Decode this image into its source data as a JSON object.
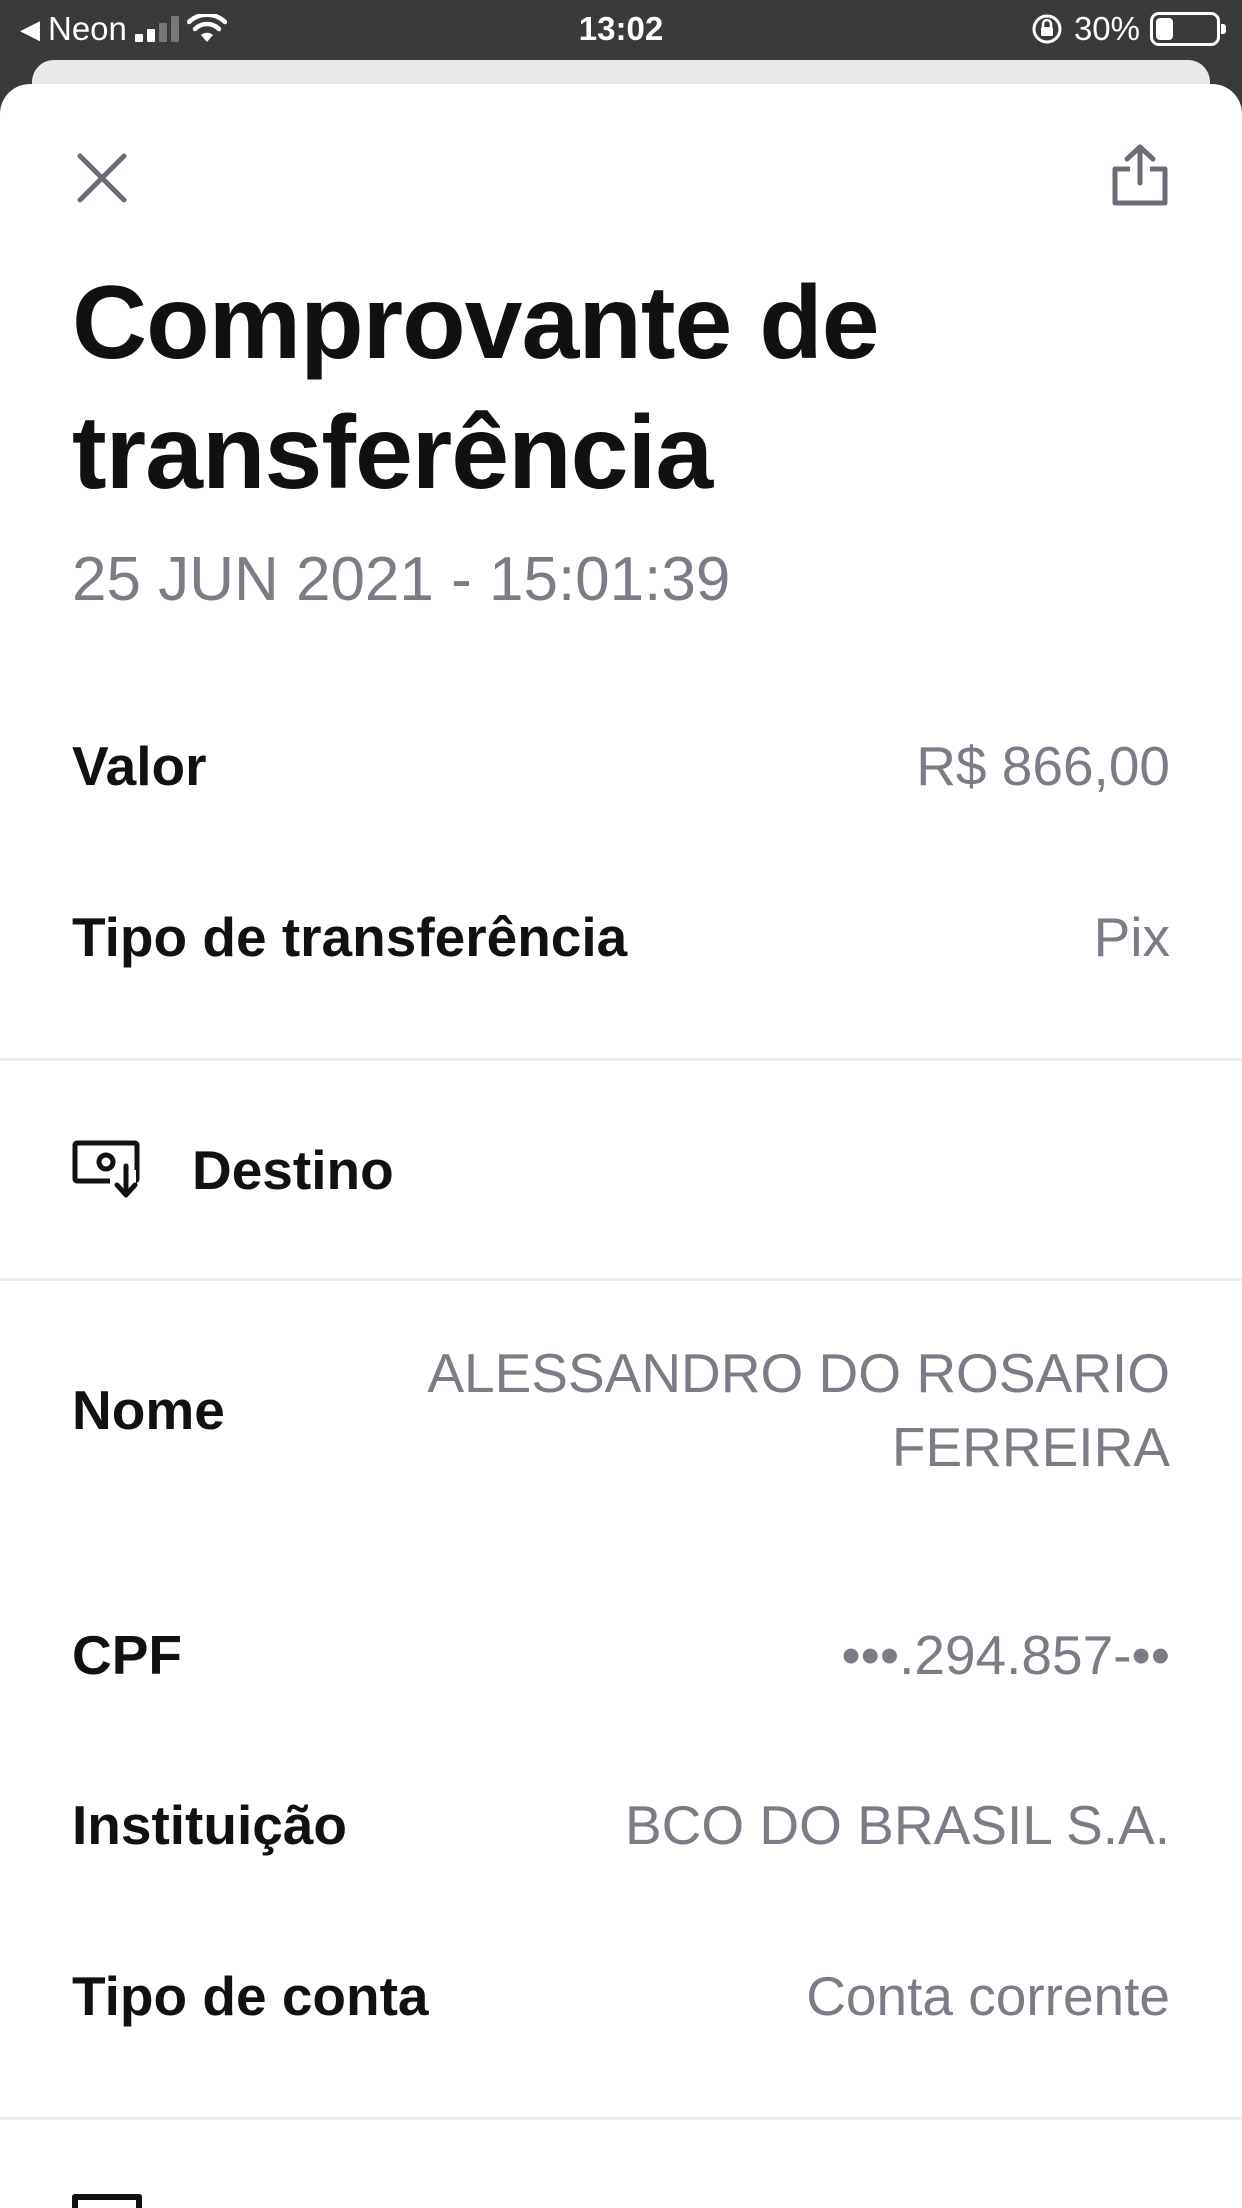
{
  "status_bar": {
    "carrier": "Neon",
    "time": "13:02",
    "battery": "30%"
  },
  "header": {
    "title_line1": "Comprovante de",
    "title_line2": "transferência",
    "date": "25 JUN 2021 - 15:01:39"
  },
  "summary": {
    "valor_label": "Valor",
    "valor_value": "R$ 866,00",
    "tipo_label": "Tipo de transferência",
    "tipo_value": "Pix"
  },
  "destino": {
    "section_title": "Destino",
    "nome_label": "Nome",
    "nome_value_line1": "ALESSANDRO DO ROSARIO",
    "nome_value_line2": "FERREIRA",
    "cpf_label": "CPF",
    "cpf_value": "•••.294.857-••",
    "instituicao_label": "Instituição",
    "instituicao_value": "BCO DO BRASIL S.A.",
    "tipo_conta_label": "Tipo de conta",
    "tipo_conta_value": "Conta corrente"
  },
  "colors": {
    "title": "#111111",
    "muted": "#7c7b86",
    "icon": "#6c6b78",
    "divider": "#ececee"
  },
  "icons": {
    "close": "close-icon",
    "share": "share-icon",
    "destino": "receive-money-icon"
  }
}
